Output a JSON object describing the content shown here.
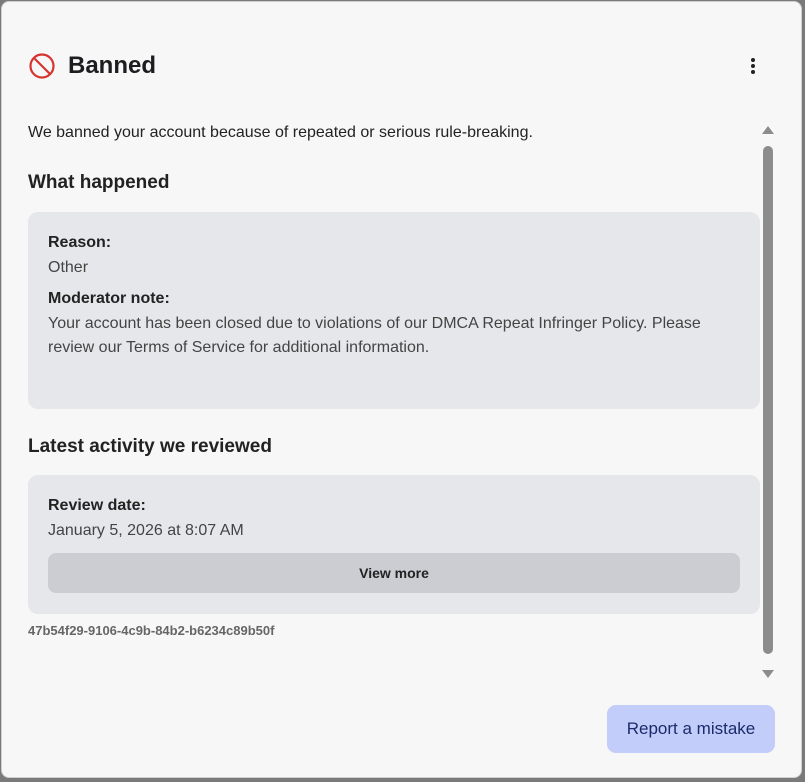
{
  "dialog": {
    "title": "Banned",
    "intro": "We banned your account because of repeated or serious rule-breaking."
  },
  "what_happened": {
    "heading": "What happened",
    "reason_label": "Reason:",
    "reason_value": "Other",
    "note_label": "Moderator note:",
    "note_value": "Your account has been closed due to violations of our DMCA Repeat Infringer Policy. Please review our Terms of Service for additional information."
  },
  "latest_activity": {
    "heading": "Latest activity we reviewed",
    "date_label": "Review date:",
    "date_value": "January 5, 2026 at 8:07 AM",
    "view_more_label": "View more"
  },
  "reference_id": "47b54f29-9106-4c9b-84b2-b6234c89b50f",
  "actions": {
    "report_label": "Report a mistake"
  },
  "colors": {
    "ban_icon": "#d6342e",
    "report_button_bg": "#c2cdfa",
    "card_bg": "#e6e7ea"
  },
  "icons": {
    "title": "ban-icon",
    "menu": "more-vertical-icon",
    "scroll_up": "triangle-up-icon",
    "scroll_down": "triangle-down-icon"
  }
}
